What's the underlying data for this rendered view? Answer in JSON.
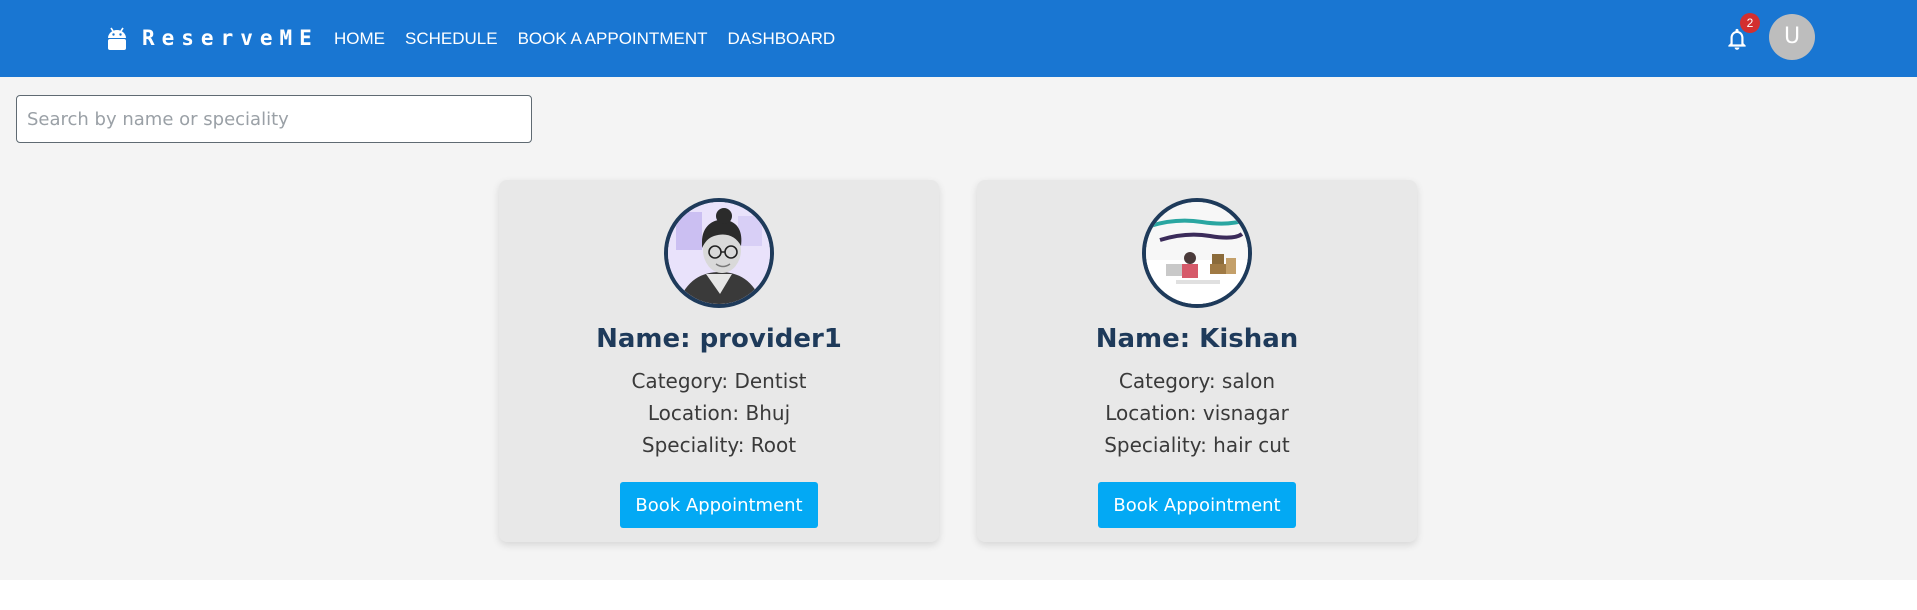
{
  "brand": {
    "name": "ReserveME",
    "logo_icon": "android-icon"
  },
  "nav": {
    "items": [
      {
        "label": "HOME"
      },
      {
        "label": "SCHEDULE"
      },
      {
        "label": "BOOK A APPOINTMENT"
      },
      {
        "label": "DASHBOARD"
      }
    ]
  },
  "notifications": {
    "count": "2",
    "icon": "bell-icon"
  },
  "user": {
    "avatar_letter": "U"
  },
  "search": {
    "placeholder": "Search by name or speciality",
    "value": ""
  },
  "providers": [
    {
      "name": "Name: provider1",
      "category": "Category: Dentist",
      "location": "Location: Bhuj",
      "speciality": "Speciality: Root",
      "button_label": "Book Appointment"
    },
    {
      "name": "Name: Kishan",
      "category": "Category: salon",
      "location": "Location: visnagar",
      "speciality": "Speciality: hair cut",
      "button_label": "Book Appointment"
    }
  ],
  "colors": {
    "appbar": "#1976d2",
    "button": "#03a9f4",
    "badge": "#d32f2f",
    "card_name": "#1e3a5a"
  }
}
